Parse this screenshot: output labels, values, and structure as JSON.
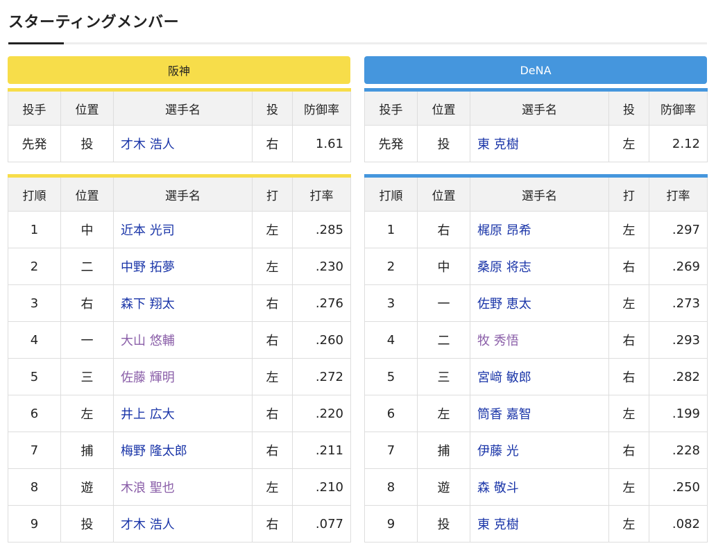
{
  "title": "スターティングメンバー",
  "colors": {
    "hanshin": "#f7dd4a",
    "dena": "#4596dd",
    "name_link": "#1a35a8",
    "name_alt": "#8a5ea8"
  },
  "pitch_headers": [
    "投手",
    "位置",
    "選手名",
    "投",
    "防御率"
  ],
  "bat_headers": [
    "打順",
    "位置",
    "選手名",
    "打",
    "打率"
  ],
  "teams": {
    "hanshin": {
      "name": "阪神",
      "pitcher": {
        "role": "先発",
        "pos": "投",
        "name": "才木 浩人",
        "hand": "右",
        "era": "1.61"
      },
      "lineup": [
        {
          "order": "1",
          "pos": "中",
          "name": "近本 光司",
          "hand": "左",
          "avg": ".285",
          "style": "blue"
        },
        {
          "order": "2",
          "pos": "二",
          "name": "中野 拓夢",
          "hand": "左",
          "avg": ".230",
          "style": "blue"
        },
        {
          "order": "3",
          "pos": "右",
          "name": "森下 翔太",
          "hand": "右",
          "avg": ".276",
          "style": "blue"
        },
        {
          "order": "4",
          "pos": "一",
          "name": "大山 悠輔",
          "hand": "右",
          "avg": ".260",
          "style": "purple"
        },
        {
          "order": "5",
          "pos": "三",
          "name": "佐藤 輝明",
          "hand": "左",
          "avg": ".272",
          "style": "purple"
        },
        {
          "order": "6",
          "pos": "左",
          "name": "井上 広大",
          "hand": "右",
          "avg": ".220",
          "style": "blue"
        },
        {
          "order": "7",
          "pos": "捕",
          "name": "梅野 隆太郎",
          "hand": "右",
          "avg": ".211",
          "style": "blue"
        },
        {
          "order": "8",
          "pos": "遊",
          "name": "木浪 聖也",
          "hand": "左",
          "avg": ".210",
          "style": "purple"
        },
        {
          "order": "9",
          "pos": "投",
          "name": "才木 浩人",
          "hand": "右",
          "avg": ".077",
          "style": "blue"
        }
      ]
    },
    "dena": {
      "name": "DeNA",
      "pitcher": {
        "role": "先発",
        "pos": "投",
        "name": "東 克樹",
        "hand": "左",
        "era": "2.12"
      },
      "lineup": [
        {
          "order": "1",
          "pos": "右",
          "name": "梶原 昂希",
          "hand": "左",
          "avg": ".297",
          "style": "blue"
        },
        {
          "order": "2",
          "pos": "中",
          "name": "桑原 将志",
          "hand": "右",
          "avg": ".269",
          "style": "blue"
        },
        {
          "order": "3",
          "pos": "一",
          "name": "佐野 恵太",
          "hand": "左",
          "avg": ".273",
          "style": "blue"
        },
        {
          "order": "4",
          "pos": "二",
          "name": "牧 秀悟",
          "hand": "右",
          "avg": ".293",
          "style": "purple"
        },
        {
          "order": "5",
          "pos": "三",
          "name": "宮﨑 敏郎",
          "hand": "右",
          "avg": ".282",
          "style": "blue"
        },
        {
          "order": "6",
          "pos": "左",
          "name": "筒香 嘉智",
          "hand": "左",
          "avg": ".199",
          "style": "blue"
        },
        {
          "order": "7",
          "pos": "捕",
          "name": "伊藤 光",
          "hand": "右",
          "avg": ".228",
          "style": "blue"
        },
        {
          "order": "8",
          "pos": "遊",
          "name": "森 敬斗",
          "hand": "左",
          "avg": ".250",
          "style": "blue"
        },
        {
          "order": "9",
          "pos": "投",
          "name": "東 克樹",
          "hand": "左",
          "avg": ".082",
          "style": "blue"
        }
      ]
    }
  }
}
